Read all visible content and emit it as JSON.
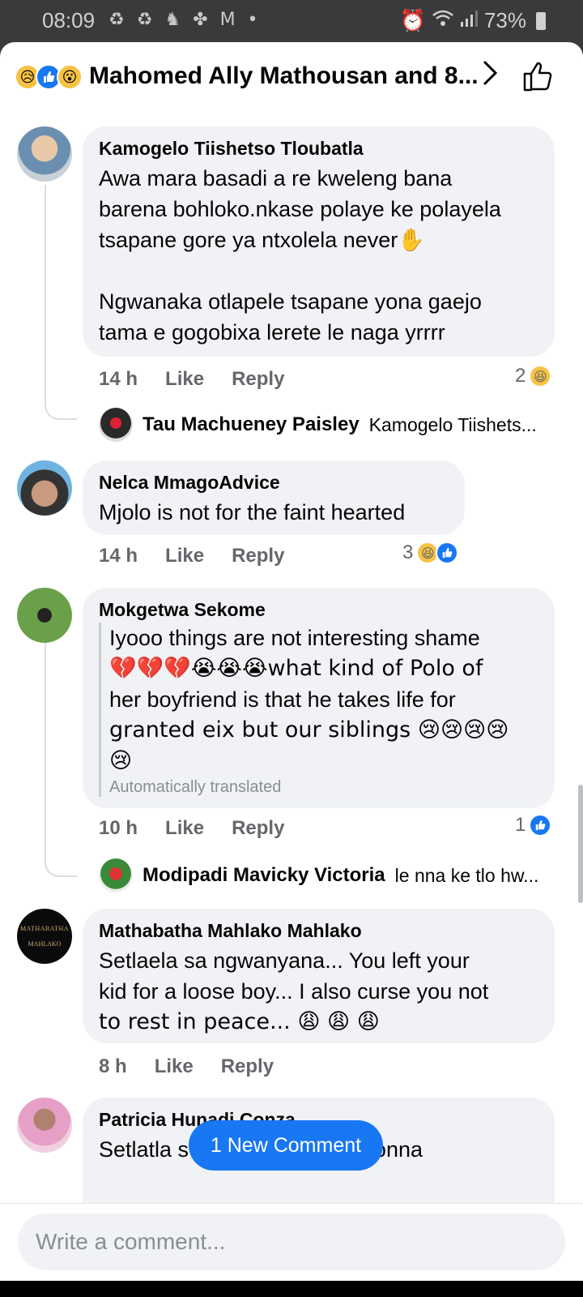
{
  "status_bar": {
    "time": "08:09",
    "left_icons": "♻ ♻ ♞ ✤ M •",
    "battery": "73%"
  },
  "header": {
    "title": "Mahomed Ally Mathousan and 8...",
    "reactions": [
      "sad",
      "like",
      "wow"
    ]
  },
  "comments": [
    {
      "author": "Kamogelo Tiishetso Tloubatla",
      "text_lines": [
        "Awa mara basadi a re kweleng bana",
        "barena bohloko.nkase polaye ke polayela",
        "tsapane gore ya ntxolela never✋",
        "",
        "Ngwanaka otlapele tsapane yona gaejo",
        "tama e gogobixa lerete le naga yrrrr"
      ],
      "time": "14 h",
      "like": "Like",
      "reply": "Reply",
      "reaction_count": "2",
      "reply_preview": {
        "name": "Tau Machueney Paisley",
        "text": "Kamogelo Tiishets..."
      }
    },
    {
      "author": "Nelca MmagoAdvice",
      "text_lines": [
        "Mjolo is not for the faint hearted"
      ],
      "time": "14 h",
      "like": "Like",
      "reply": "Reply",
      "reaction_count": "3"
    },
    {
      "author": "Mokgetwa Sekome",
      "text_lines": [
        "Iyooo things are not interesting shame",
        "💔💔💔😭😭😭what kind of Polo of",
        "her boyfriend is that he takes life for",
        "granted eix but our siblings 😢😢😢😢",
        "😢"
      ],
      "translated": "Automatically translated",
      "time": "10 h",
      "like": "Like",
      "reply": "Reply",
      "reaction_count": "1",
      "reply_preview": {
        "name": "Modipadi Mavicky Victoria",
        "text": "le nna ke tlo hw..."
      }
    },
    {
      "author": "Mathabatha Mahlako Mahlako",
      "avatar_text": [
        "MATHABATHA",
        "MAHLAKO"
      ],
      "text_lines": [
        "Setlaela sa ngwanyana... You left your",
        "kid for a loose boy... I also curse you not",
        "to rest in peace... 😩 😩 😩"
      ],
      "time": "8 h",
      "like": "Like",
      "reply": "Reply"
    },
    {
      "author": "Patricia Hunadi Conza",
      "text_lines": [
        "Setlatla s",
        "onna"
      ]
    }
  ],
  "new_comment_pill": "1 New Comment",
  "composer": {
    "placeholder": "Write a comment..."
  }
}
